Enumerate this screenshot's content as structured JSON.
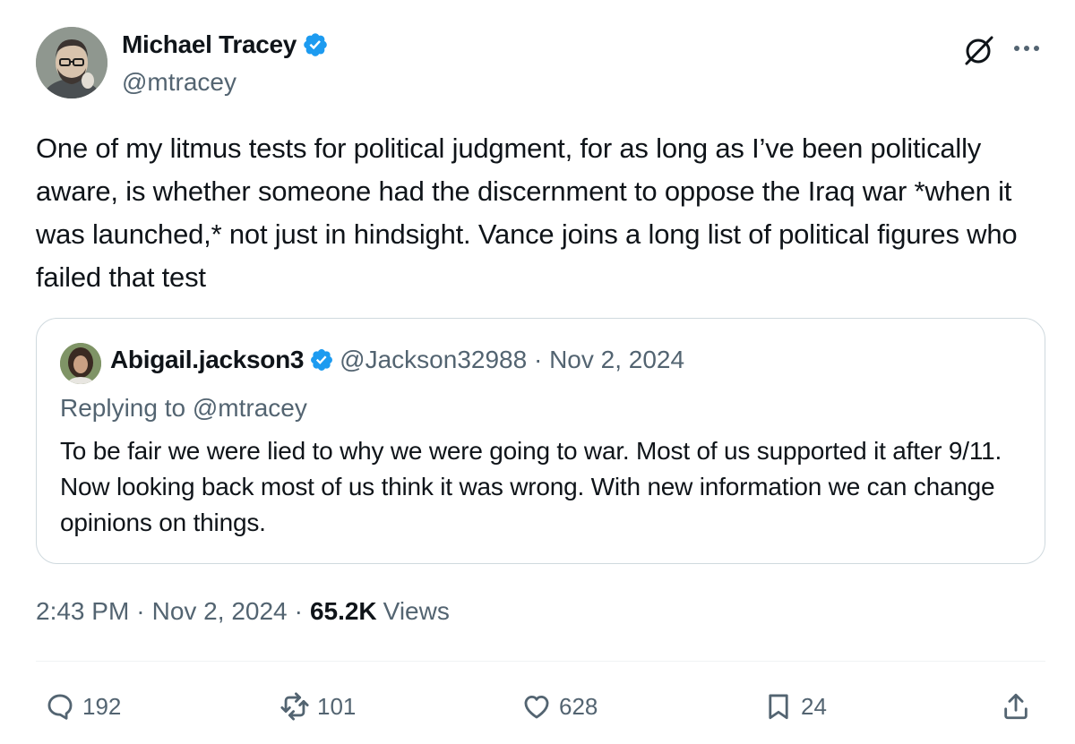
{
  "author": {
    "name": "Michael Tracey",
    "handle": "@mtracey",
    "verified": true
  },
  "post": {
    "text": "One of my litmus tests for political judgment, for as long as I’ve been politically aware, is whether someone had the discernment to oppose the Iraq war *when it was launched,* not just in hindsight. Vance joins a long list of political figures who failed that test",
    "time": "2:43 PM",
    "date": "Nov 2, 2024",
    "views_count": "65.2K",
    "views_label": "Views"
  },
  "quote": {
    "name": "Abigail.jackson3",
    "handle": "@Jackson32988",
    "date": "Nov 2, 2024",
    "verified": true,
    "replying_to": "Replying to @mtracey",
    "text": "To be fair we were lied to why we were going to war. Most of us supported it after 9/11. Now looking back most of us think it was wrong. With new information we can change opinions on things."
  },
  "actions": {
    "replies": "192",
    "reposts": "101",
    "likes": "628",
    "bookmarks": "24"
  },
  "icons": {
    "header": [
      "grok-icon",
      "more-icon"
    ],
    "actions": [
      "reply-icon",
      "repost-icon",
      "like-icon",
      "bookmark-icon",
      "share-icon"
    ]
  },
  "colors": {
    "verified_blue": "#1d9bf0",
    "secondary_text": "#536471",
    "primary_text": "#0f1419",
    "border": "#cfd9de"
  }
}
